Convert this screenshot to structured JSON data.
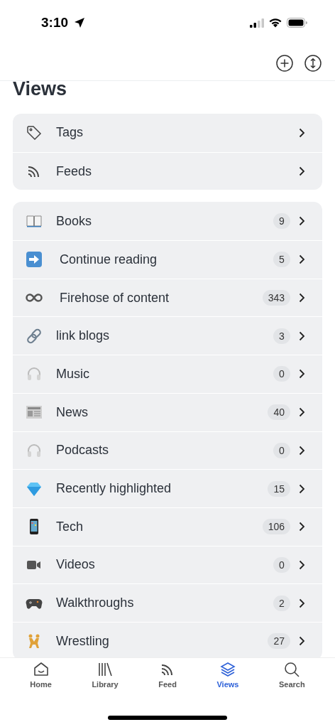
{
  "status_bar": {
    "time": "3:10"
  },
  "title": "Views",
  "system_views": [
    {
      "label": "Tags",
      "kind": "tag"
    },
    {
      "label": "Feeds",
      "kind": "rss"
    }
  ],
  "views": [
    {
      "label": "Books",
      "kind": "book",
      "count": "9"
    },
    {
      "label": "Continue reading",
      "kind": "arrow",
      "count": "5"
    },
    {
      "label": "Firehose of content",
      "kind": "infinity",
      "count": "343"
    },
    {
      "label": "link blogs",
      "kind": "link",
      "count": "3"
    },
    {
      "label": "Music",
      "kind": "headphones",
      "count": "0"
    },
    {
      "label": "News",
      "kind": "newspaper",
      "count": "40"
    },
    {
      "label": "Podcasts",
      "kind": "headphones",
      "count": "0"
    },
    {
      "label": "Recently highlighted",
      "kind": "gem",
      "count": "15"
    },
    {
      "label": "Tech",
      "kind": "phone",
      "count": "106"
    },
    {
      "label": "Videos",
      "kind": "video",
      "count": "0"
    },
    {
      "label": "Walkthroughs",
      "kind": "gamepad",
      "count": "2"
    },
    {
      "label": "Wrestling",
      "kind": "wrestlers",
      "count": "27"
    }
  ],
  "tab_bar": [
    {
      "label": "Home",
      "kind": "home",
      "selected": false
    },
    {
      "label": "Library",
      "kind": "library",
      "selected": false
    },
    {
      "label": "Feed",
      "kind": "rss",
      "selected": false
    },
    {
      "label": "Views",
      "kind": "layers",
      "selected": true
    },
    {
      "label": "Search",
      "kind": "search",
      "selected": false
    }
  ]
}
